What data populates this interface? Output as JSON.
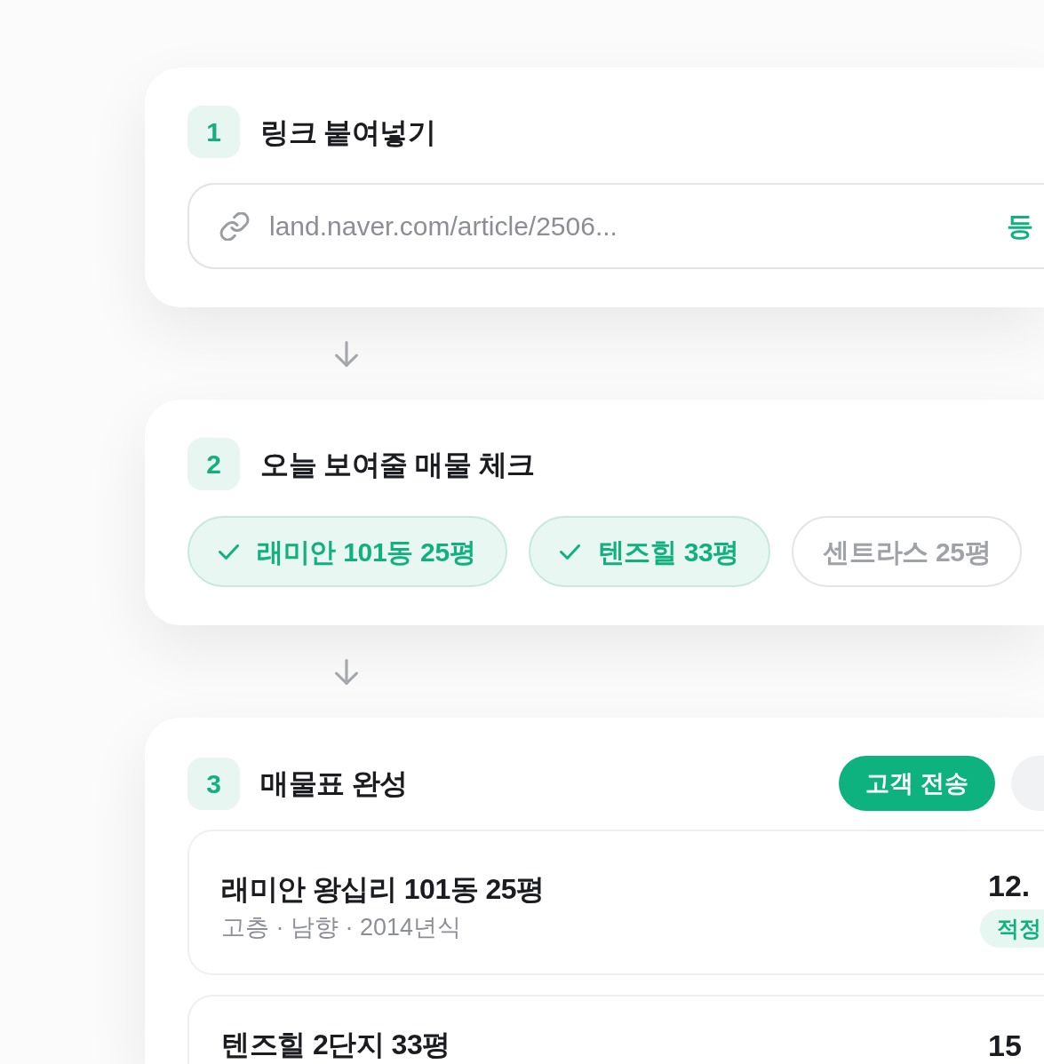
{
  "steps": [
    {
      "number": "1",
      "title": "링크 붙여넣기",
      "kind": "link",
      "input": {
        "placeholder": "land.naver.com/article/2506..."
      },
      "submit": "등"
    },
    {
      "number": "2",
      "title": "오늘 보여줄 매물 체크",
      "kind": "chips",
      "chips": [
        {
          "label": "래미안 101동 25평",
          "selected": true
        },
        {
          "label": "텐즈힐 33평",
          "selected": true
        },
        {
          "label": "센트라스 25평",
          "selected": false
        }
      ]
    },
    {
      "number": "3",
      "title": "매물표 완성",
      "kind": "listings",
      "actions": [
        {
          "kind": "primary",
          "label": "고객 전송"
        },
        {
          "kind": "secondary"
        }
      ],
      "listings": [
        {
          "title": "래미안 왕십리 101동 25평",
          "details": "고층 · 남향 · 2014년식",
          "price": "12.",
          "badge": "적정"
        },
        {
          "title": "텐즈힐 2단지 33평",
          "price": "15"
        }
      ]
    }
  ]
}
